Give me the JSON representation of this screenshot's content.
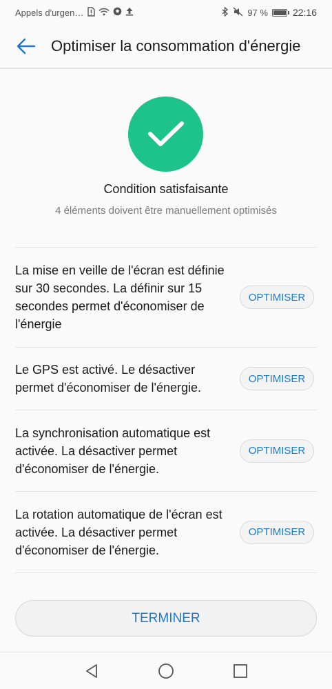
{
  "status_bar": {
    "carrier_text": "Appels d'urgen…",
    "battery_text": "97 %",
    "battery_level": 0.97,
    "time": "22:16",
    "icons": [
      "alert-sim-icon",
      "wifi-icon",
      "soccer-ball-icon",
      "upload-icon",
      "bluetooth-icon",
      "mute-icon",
      "battery-icon"
    ]
  },
  "app_bar": {
    "title": "Optimiser la consommation d'énergie",
    "back_icon": "back-arrow-icon"
  },
  "summary": {
    "icon": "check-icon",
    "title": "Condition satisfaisante",
    "subtitle": "4 éléments doivent être manuellement optimisés"
  },
  "issues": [
    {
      "text": "La mise en veille de l'écran est définie sur 30 secondes. La définir sur 15 secondes permet d'économiser de l'énergie",
      "button_label": "OPTIMISER"
    },
    {
      "text": "Le GPS est activé. Le désactiver permet d'économiser de l'énergie.",
      "button_label": "OPTIMISER"
    },
    {
      "text": "La synchronisation automatique est activée. La désactiver permet d'économiser de l'énergie.",
      "button_label": "OPTIMISER"
    },
    {
      "text": "La rotation automatique de l'écran est activée. La désactiver permet d'économiser de l'énergie.",
      "button_label": "OPTIMISER"
    }
  ],
  "footer": {
    "finish_label": "TERMINER"
  },
  "colors": {
    "accent": "#1e78c8",
    "success": "#1ec28b",
    "background": "#fafafa"
  }
}
